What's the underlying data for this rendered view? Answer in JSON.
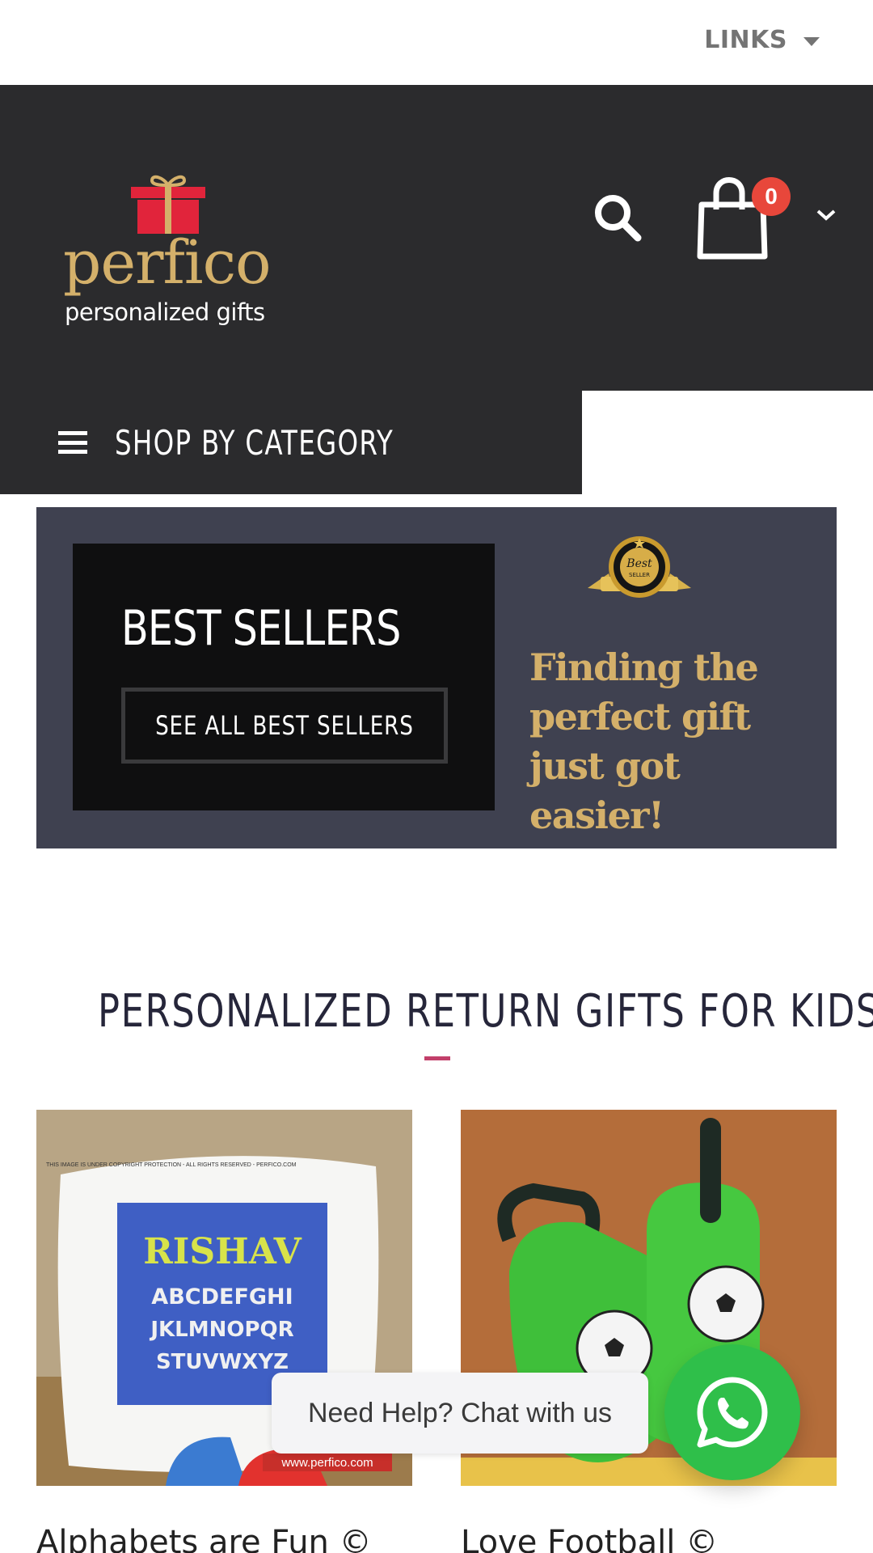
{
  "topbar": {
    "links_label": "LINKS"
  },
  "header": {
    "logo_brand": "perfico",
    "logo_tagline": "personalized gifts",
    "cart_count": "0"
  },
  "nav": {
    "category_label": "SHOP BY CATEGORY"
  },
  "banner": {
    "title": "BEST SELLERS",
    "button_label": "SEE ALL BEST SELLERS",
    "badge_line1": "Best",
    "badge_line2": "SELLER",
    "tagline_line1": "Finding the",
    "tagline_line2": "perfect gift",
    "tagline_line3": "just got easier!"
  },
  "section": {
    "title": "PERSONALIZED RETURN GIFTS FOR KIDS"
  },
  "products": [
    {
      "name": "Alphabets are Fun ©",
      "image_name": "RISHAV",
      "image_letters_1": "ABCDEFGHI",
      "image_letters_2": "JKLMNOPQR",
      "image_letters_3": "STUVWXYZ",
      "image_footer": "www.perfico.com",
      "image_notice": "THIS IMAGE IS UNDER COPYRIGHT PROTECTION - ALL RIGHTS RESERVED - PERFICO.COM"
    },
    {
      "name": "Love Football ©"
    }
  ],
  "chat": {
    "label": "Need Help? Chat with us"
  },
  "colors": {
    "header_bg": "#2b2b2d",
    "banner_bg": "#3f4150",
    "gold": "#d4b06a",
    "badge_red": "#e8473b",
    "accent": "#c23f6a",
    "whatsapp_green": "#2fbf4a"
  },
  "icons": [
    "chevron-down-icon",
    "search-icon",
    "cart-icon",
    "hamburger-icon",
    "whatsapp-icon",
    "gift-logo-icon",
    "best-seller-badge-icon"
  ]
}
